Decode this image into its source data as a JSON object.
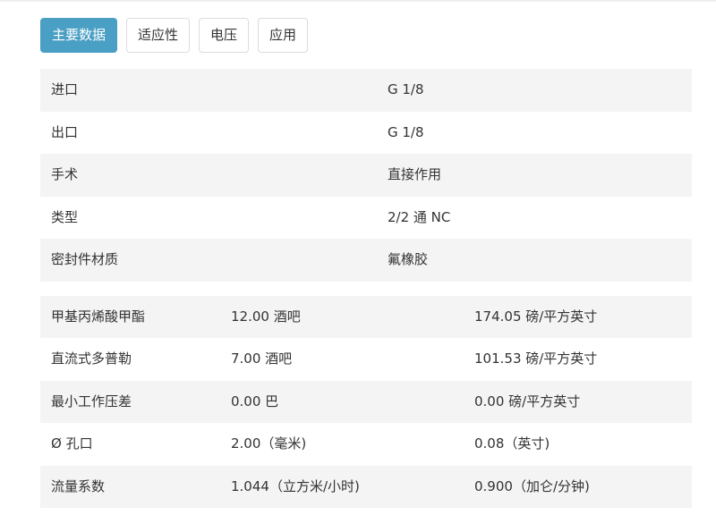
{
  "tabs": [
    {
      "label": "主要数据",
      "active": true
    },
    {
      "label": "适应性",
      "active": false
    },
    {
      "label": "电压",
      "active": false
    },
    {
      "label": "应用",
      "active": false
    }
  ],
  "general_table": [
    {
      "label": "进口",
      "value": "G 1/8"
    },
    {
      "label": "出口",
      "value": "G 1/8"
    },
    {
      "label": "手术",
      "value": "直接作用"
    },
    {
      "label": "类型",
      "value": "2/2 通 NC"
    },
    {
      "label": "密封件材质",
      "value": "氟橡胶"
    }
  ],
  "spec_table": [
    {
      "label": "甲基丙烯酸甲酯",
      "metric": "12.00 酒吧",
      "imperial": "174.05 磅/平方英寸"
    },
    {
      "label": "直流式多普勒",
      "metric": "7.00 酒吧",
      "imperial": "101.53 磅/平方英寸"
    },
    {
      "label": "最小工作压差",
      "metric": "0.00 巴",
      "imperial": "0.00 磅/平方英寸"
    },
    {
      "label": "Ø 孔口",
      "metric": "2.00（毫米)",
      "imperial": "0.08（英寸)"
    },
    {
      "label": "流量系数",
      "metric": "1.044（立方米/小时)",
      "imperial": "0.900（加仑/分钟)"
    }
  ]
}
